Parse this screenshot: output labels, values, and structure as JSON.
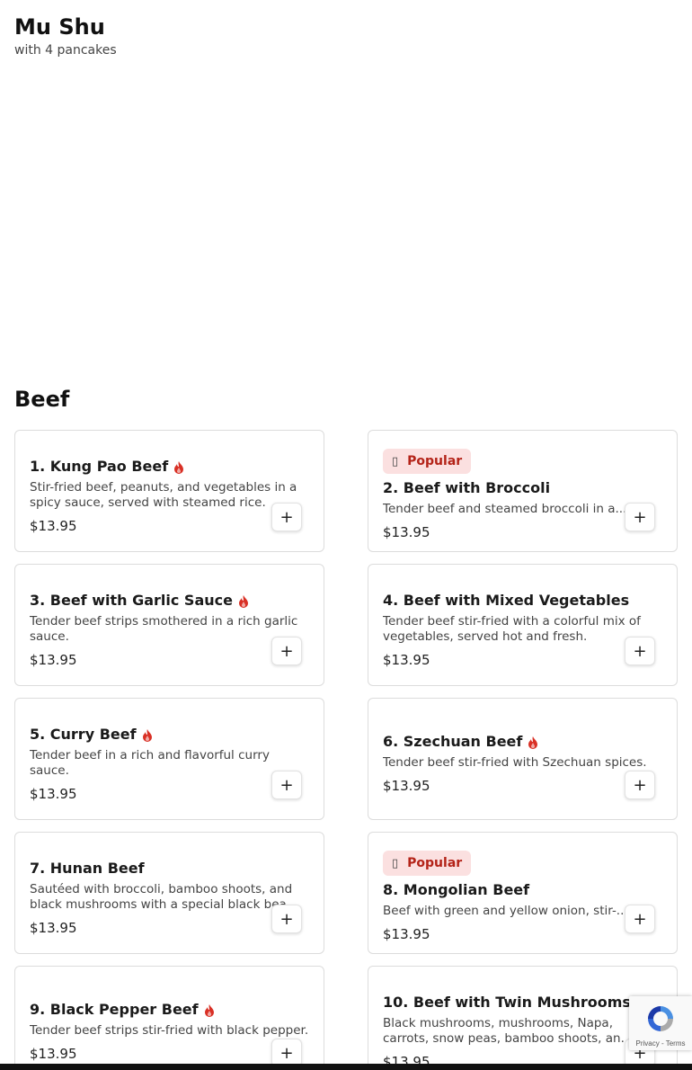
{
  "top_item": {
    "title": "Mu Shu",
    "subtitle": "with 4 pancakes"
  },
  "section": {
    "title": "Beef"
  },
  "popular_label": "Popular",
  "add_label": "+",
  "colors": {
    "popular_bg": "#fbe0e0",
    "popular_text": "#b42318",
    "spicy": "#d93025"
  },
  "items": [
    {
      "name": "1. Kung Pao Beef",
      "spicy": true,
      "popular": false,
      "desc": "Stir-fried beef, peanuts, and vegetables in a spicy sauce, served with steamed rice.",
      "price": "$13.95"
    },
    {
      "name": "2. Beef with Broccoli",
      "spicy": false,
      "popular": true,
      "desc": "Tender beef and steamed broccoli in a...",
      "price": "$13.95"
    },
    {
      "name": "3. Beef with Garlic Sauce",
      "spicy": true,
      "popular": false,
      "desc": "Tender beef strips smothered in a rich garlic sauce.",
      "price": "$13.95"
    },
    {
      "name": "4. Beef with Mixed Vegetables",
      "spicy": false,
      "popular": false,
      "desc": "Tender beef stir-fried with a colorful mix of vegetables, served hot and fresh.",
      "price": "$13.95"
    },
    {
      "name": "5. Curry Beef",
      "spicy": true,
      "popular": false,
      "desc": "Tender beef in a rich and flavorful curry sauce.",
      "price": "$13.95"
    },
    {
      "name": "6. Szechuan Beef",
      "spicy": true,
      "popular": false,
      "desc": "Tender beef stir-fried with Szechuan spices.",
      "price": "$13.95"
    },
    {
      "name": "7. Hunan Beef",
      "spicy": false,
      "popular": false,
      "desc": "Sautéed with broccoli, bamboo shoots, and black mushrooms with a special black bea...",
      "price": "$13.95"
    },
    {
      "name": "8. Mongolian Beef",
      "spicy": false,
      "popular": true,
      "desc": "Beef with green and yellow onion, stir-...",
      "price": "$13.95"
    },
    {
      "name": "9. Black Pepper Beef",
      "spicy": true,
      "popular": false,
      "desc": "Tender beef strips stir-fried with black pepper.",
      "price": "$13.95"
    },
    {
      "name": "10. Beef with Twin Mushrooms",
      "spicy": false,
      "popular": false,
      "desc": "Black mushrooms, mushrooms, Napa, carrots, snow peas, bamboo shoots, an...",
      "price": "$13.95"
    }
  ],
  "recaptcha": {
    "text": "Privacy - Terms"
  }
}
